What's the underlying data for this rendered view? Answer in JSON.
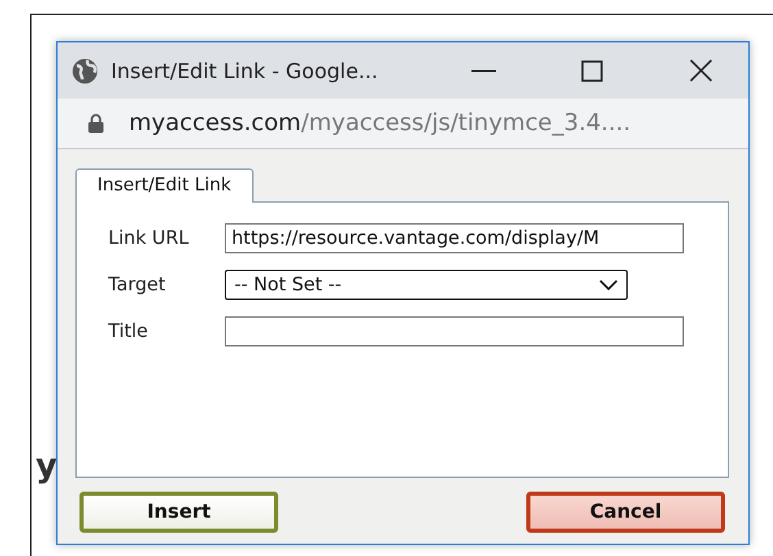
{
  "background": {
    "fragment": "y"
  },
  "window": {
    "title": "Insert/Edit Link - Google...",
    "address_host": "myaccess.com",
    "address_path": "/myaccess/js/tinymce_3.4...."
  },
  "tabs": [
    {
      "label": "Insert/Edit Link",
      "selected": true
    }
  ],
  "fields": [
    {
      "kind": "text",
      "label": "Link URL",
      "value": "https://resource.vantage.com/display/M"
    },
    {
      "kind": "select",
      "label": "Target",
      "value": "-- Not Set --"
    },
    {
      "kind": "text",
      "label": "Title"
    }
  ],
  "buttons": [
    {
      "kind": "confirm",
      "label": "Insert"
    },
    {
      "kind": "cancel",
      "label": "Cancel"
    }
  ]
}
